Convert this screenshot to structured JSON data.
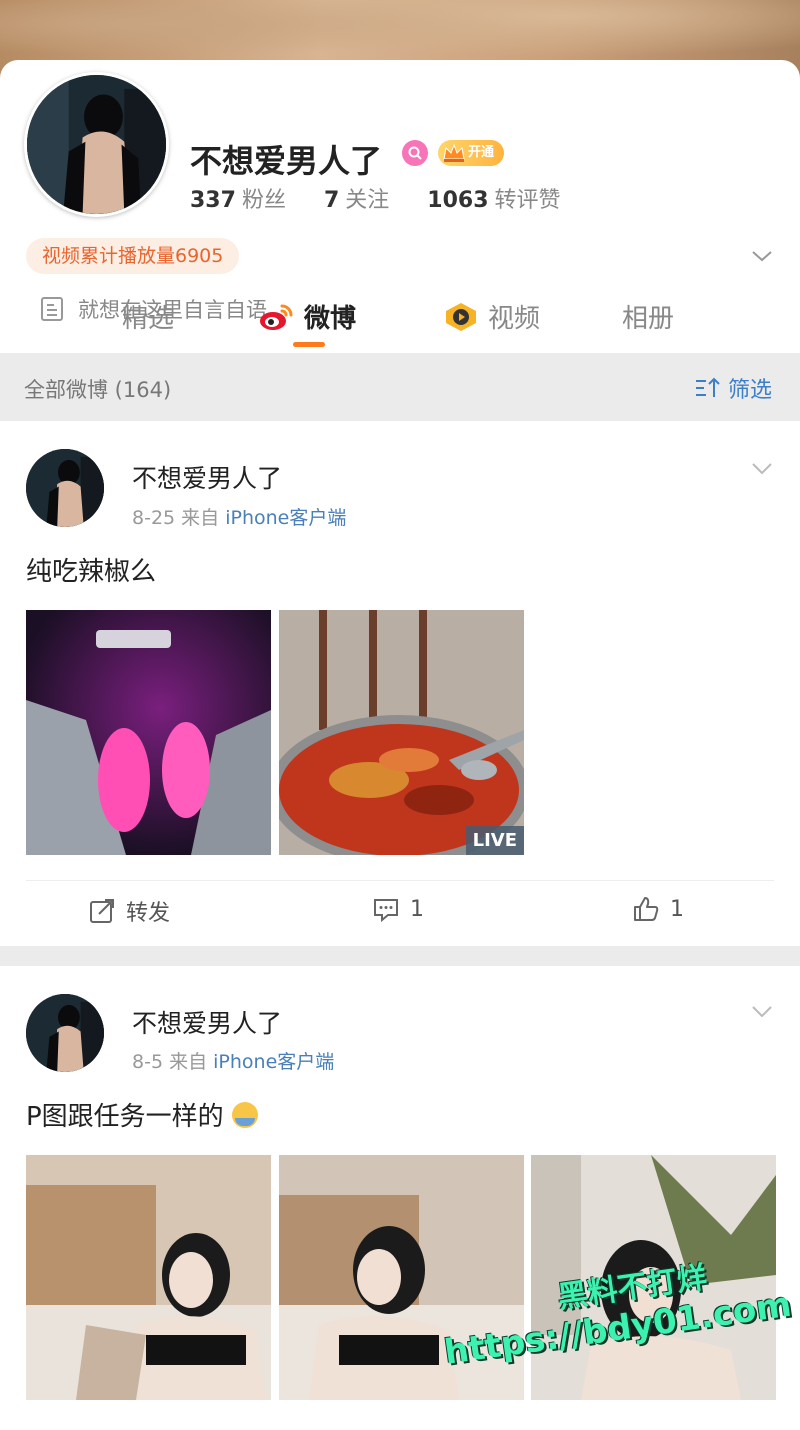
{
  "profile": {
    "name": "不想爱男人了",
    "vip_label": "开通",
    "stats": [
      {
        "value": "337",
        "label": "粉丝"
      },
      {
        "value": "7",
        "label": "关注"
      },
      {
        "value": "1063",
        "label": "转评赞"
      }
    ],
    "video_plays": "视频累计播放量6905",
    "bio": "就想在这里自言自语",
    "tabs": [
      {
        "label": "精选"
      },
      {
        "label": "微博",
        "active": true
      },
      {
        "label": "视频"
      },
      {
        "label": "相册"
      }
    ]
  },
  "filter": {
    "count_label": "全部微博 (164)",
    "filter_label": "筛选"
  },
  "posts": [
    {
      "author": "不想爱男人了",
      "date": "8-25",
      "from": "来自",
      "source": "iPhone客户端",
      "text": "纯吃辣椒么",
      "live_label": "LIVE",
      "actions": {
        "repost": "转发",
        "comments": "1",
        "likes": "1"
      }
    },
    {
      "author": "不想爱男人了",
      "date": "8-5",
      "from": "来自",
      "source": "iPhone客户端",
      "text": "P图跟任务一样的"
    }
  ],
  "watermark": {
    "line1": "黑料不打烊",
    "line2": "https://bdy01.com"
  },
  "colors": {
    "accent": "#ff7a1a",
    "link": "#3d7ec9",
    "pill_text": "#e8652e"
  }
}
